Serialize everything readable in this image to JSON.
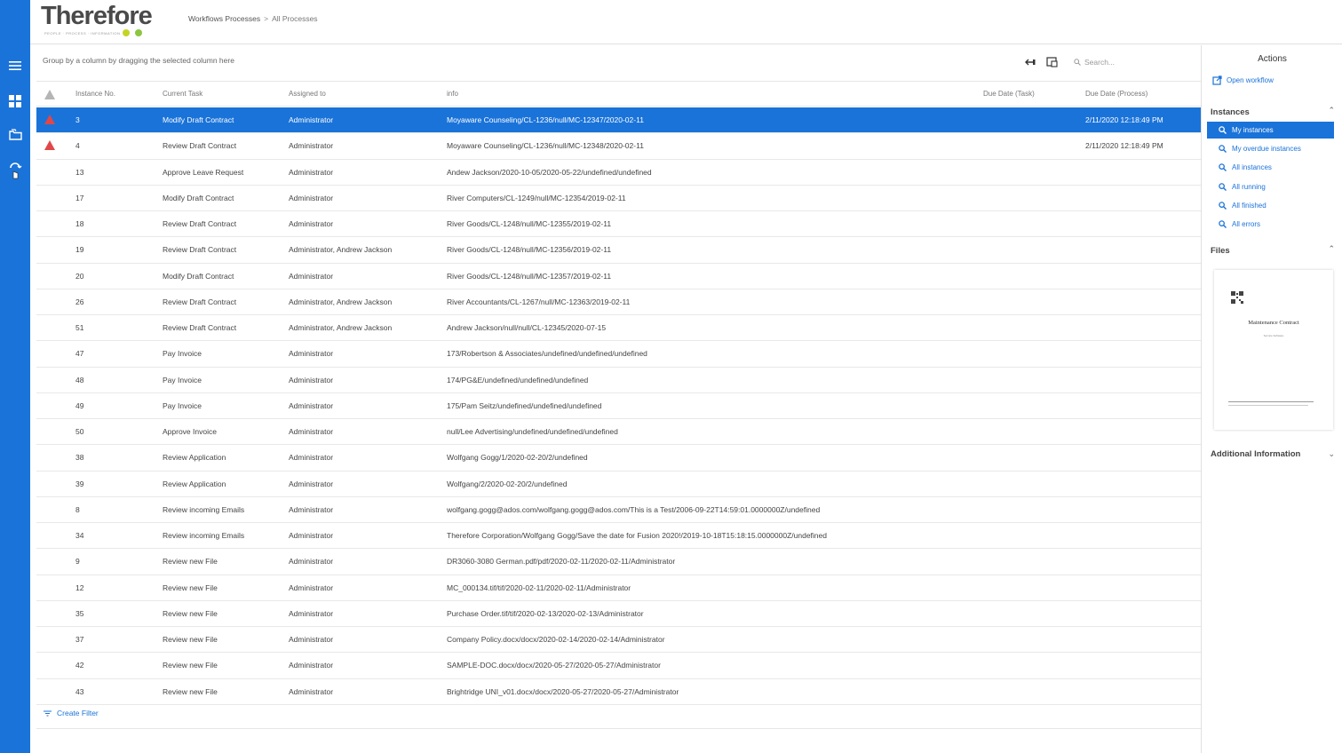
{
  "app": {
    "logo_text": "Therefore",
    "logo_tagline": "PEOPLE · PROCESS · INFORMATION",
    "brand_color": "#1a73d9",
    "warn_color": "#e04848"
  },
  "breadcrumb": {
    "part1": "Workflows Processes",
    "separator": ">",
    "part2": "All Processes"
  },
  "toolbar": {
    "group_hint": "Group by a column by dragging the selected column here",
    "search_placeholder": "Search..."
  },
  "columns": {
    "instance_no": "Instance No.",
    "current_task": "Current Task",
    "assigned_to": "Assigned to",
    "info": "info",
    "due_task": "Due Date (Task)",
    "due_process": "Due Date (Process)"
  },
  "rows": [
    {
      "no": "3",
      "task": "Modify Draft Contract",
      "assigned": "Administrator",
      "info": "Moyaware Counseling/CL-1236/null/MC-12347/2020-02-11",
      "due_task": "",
      "due_process": "2/11/2020 12:18:49 PM",
      "warn": true,
      "selected": true
    },
    {
      "no": "4",
      "task": "Review Draft Contract",
      "assigned": "Administrator",
      "info": "Moyaware Counseling/CL-1236/null/MC-12348/2020-02-11",
      "due_task": "",
      "due_process": "2/11/2020 12:18:49 PM",
      "warn": true,
      "selected": false
    },
    {
      "no": "13",
      "task": "Approve Leave Request",
      "assigned": "Administrator",
      "info": "Andew Jackson/2020-10-05/2020-05-22/undefined/undefined",
      "due_task": "",
      "due_process": "",
      "warn": false,
      "selected": false
    },
    {
      "no": "17",
      "task": "Modify Draft Contract",
      "assigned": "Administrator",
      "info": "River Computers/CL-1249/null/MC-12354/2019-02-11",
      "due_task": "",
      "due_process": "",
      "warn": false,
      "selected": false
    },
    {
      "no": "18",
      "task": "Review Draft Contract",
      "assigned": "Administrator",
      "info": "River Goods/CL-1248/null/MC-12355/2019-02-11",
      "due_task": "",
      "due_process": "",
      "warn": false,
      "selected": false
    },
    {
      "no": "19",
      "task": "Review Draft Contract",
      "assigned": "Administrator, Andrew Jackson",
      "info": "River Goods/CL-1248/null/MC-12356/2019-02-11",
      "due_task": "",
      "due_process": "",
      "warn": false,
      "selected": false
    },
    {
      "no": "20",
      "task": "Modify Draft Contract",
      "assigned": "Administrator",
      "info": "River Goods/CL-1248/null/MC-12357/2019-02-11",
      "due_task": "",
      "due_process": "",
      "warn": false,
      "selected": false
    },
    {
      "no": "26",
      "task": "Review Draft Contract",
      "assigned": "Administrator, Andrew Jackson",
      "info": "River Accountants/CL-1267/null/MC-12363/2019-02-11",
      "due_task": "",
      "due_process": "",
      "warn": false,
      "selected": false
    },
    {
      "no": "51",
      "task": "Review Draft Contract",
      "assigned": "Administrator, Andrew Jackson",
      "info": "Andrew Jackson/null/null/CL-12345/2020-07-15",
      "due_task": "",
      "due_process": "",
      "warn": false,
      "selected": false
    },
    {
      "no": "47",
      "task": "Pay Invoice",
      "assigned": "Administrator",
      "info": "173/Robertson & Associates/undefined/undefined/undefined",
      "due_task": "",
      "due_process": "",
      "warn": false,
      "selected": false
    },
    {
      "no": "48",
      "task": "Pay Invoice",
      "assigned": "Administrator",
      "info": "174/PG&E/undefined/undefined/undefined",
      "due_task": "",
      "due_process": "",
      "warn": false,
      "selected": false
    },
    {
      "no": "49",
      "task": "Pay Invoice",
      "assigned": "Administrator",
      "info": "175/Pam Seitz/undefined/undefined/undefined",
      "due_task": "",
      "due_process": "",
      "warn": false,
      "selected": false
    },
    {
      "no": "50",
      "task": "Approve Invoice",
      "assigned": "Administrator",
      "info": "null/Lee Advertising/undefined/undefined/undefined",
      "due_task": "",
      "due_process": "",
      "warn": false,
      "selected": false
    },
    {
      "no": "38",
      "task": "Review Application",
      "assigned": "Administrator",
      "info": "Wolfgang Gogg/1/2020-02-20/2/undefined",
      "due_task": "",
      "due_process": "",
      "warn": false,
      "selected": false
    },
    {
      "no": "39",
      "task": "Review Application",
      "assigned": "Administrator",
      "info": "Wolfgang/2/2020-02-20/2/undefined",
      "due_task": "",
      "due_process": "",
      "warn": false,
      "selected": false
    },
    {
      "no": "8",
      "task": "Review incoming Emails",
      "assigned": "Administrator",
      "info": "wolfgang.gogg@ados.com/wolfgang.gogg@ados.com/This is a Test/2006-09-22T14:59:01.0000000Z/undefined",
      "due_task": "",
      "due_process": "",
      "warn": false,
      "selected": false
    },
    {
      "no": "34",
      "task": "Review incoming Emails",
      "assigned": "Administrator",
      "info": "Therefore Corporation/Wolfgang Gogg/Save the date for Fusion 2020!/2019-10-18T15:18:15.0000000Z/undefined",
      "due_task": "",
      "due_process": "",
      "warn": false,
      "selected": false
    },
    {
      "no": "9",
      "task": "Review new File",
      "assigned": "Administrator",
      "info": "DR3060-3080 German.pdf/pdf/2020-02-11/2020-02-11/Administrator",
      "due_task": "",
      "due_process": "",
      "warn": false,
      "selected": false
    },
    {
      "no": "12",
      "task": "Review new File",
      "assigned": "Administrator",
      "info": "MC_000134.tif/tif/2020-02-11/2020-02-11/Administrator",
      "due_task": "",
      "due_process": "",
      "warn": false,
      "selected": false
    },
    {
      "no": "35",
      "task": "Review new File",
      "assigned": "Administrator",
      "info": "Purchase Order.tif/tif/2020-02-13/2020-02-13/Administrator",
      "due_task": "",
      "due_process": "",
      "warn": false,
      "selected": false
    },
    {
      "no": "37",
      "task": "Review new File",
      "assigned": "Administrator",
      "info": "Company Policy.docx/docx/2020-02-14/2020-02-14/Administrator",
      "due_task": "",
      "due_process": "",
      "warn": false,
      "selected": false
    },
    {
      "no": "42",
      "task": "Review new File",
      "assigned": "Administrator",
      "info": "SAMPLE-DOC.docx/docx/2020-05-27/2020-05-27/Administrator",
      "due_task": "",
      "due_process": "",
      "warn": false,
      "selected": false
    },
    {
      "no": "43",
      "task": "Review new File",
      "assigned": "Administrator",
      "info": "Brightridge UNI_v01.docx/docx/2020-05-27/2020-05-27/Administrator",
      "due_task": "",
      "due_process": "",
      "warn": false,
      "selected": false
    }
  ],
  "footer": {
    "create_filter": "Create Filter"
  },
  "actions": {
    "title": "Actions",
    "open_workflow": "Open workflow"
  },
  "instances": {
    "title": "Instances",
    "items": [
      {
        "label": "My instances",
        "active": true
      },
      {
        "label": "My overdue instances",
        "active": false
      },
      {
        "label": "All instances",
        "active": false
      },
      {
        "label": "All running",
        "active": false
      },
      {
        "label": "All finished",
        "active": false
      },
      {
        "label": "All errors",
        "active": false
      }
    ]
  },
  "files": {
    "title": "Files",
    "thumb_title": "Maintenance Contract",
    "thumb_subtitle": "Service Software"
  },
  "additional": {
    "title": "Additional Information"
  }
}
